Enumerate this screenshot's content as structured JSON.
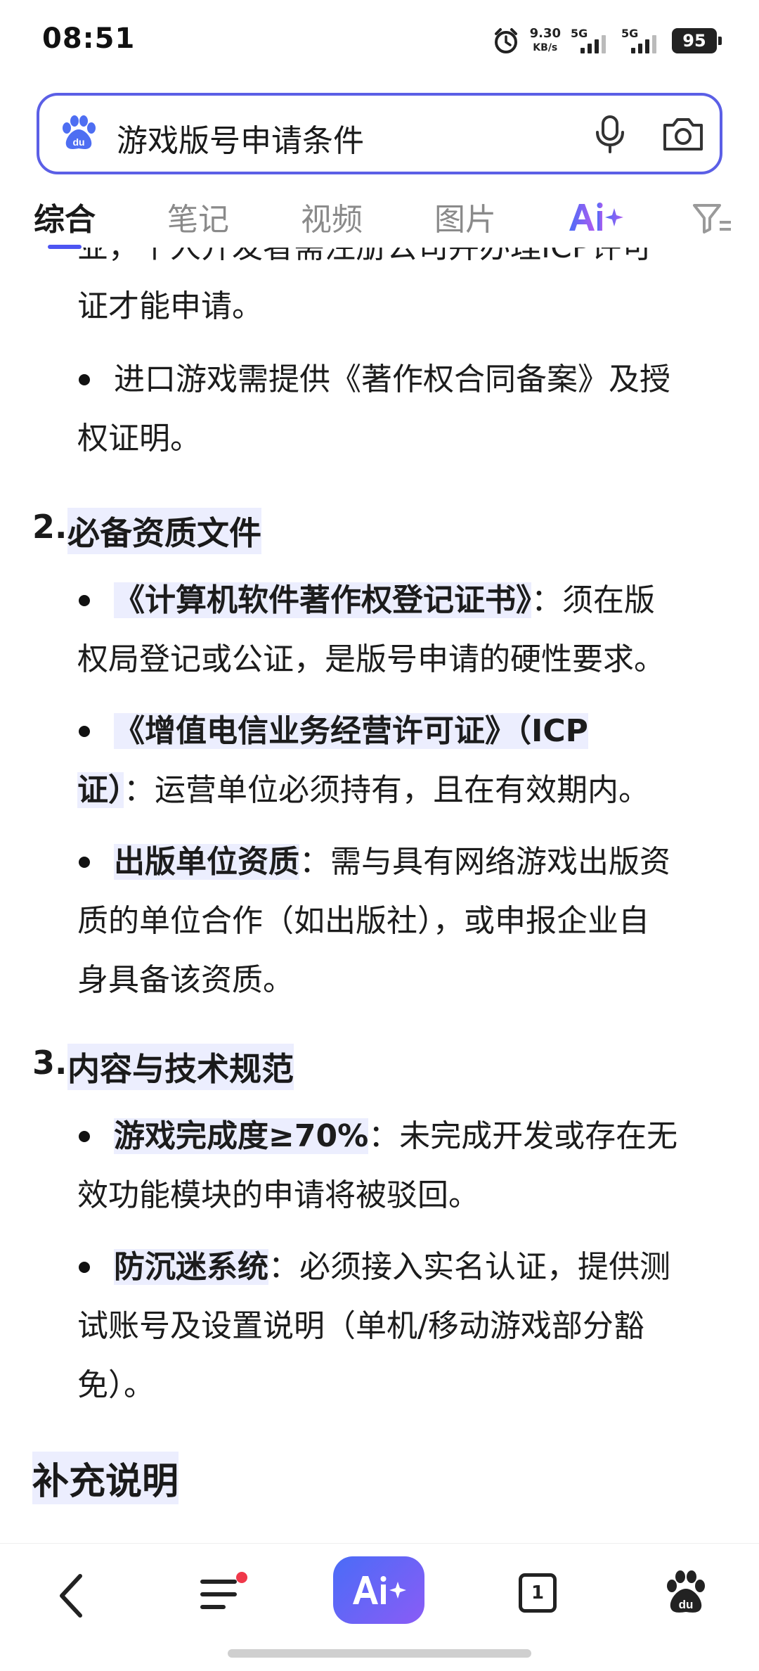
{
  "status": {
    "time": "08:51",
    "speed_value": "9.30",
    "speed_unit": "KB/s",
    "sim1": "5G",
    "sim2": "5G",
    "battery": "95"
  },
  "search": {
    "query": "游戏版号申请条件"
  },
  "tabs": [
    {
      "label": "综合",
      "active": true
    },
    {
      "label": "笔记"
    },
    {
      "label": "视频"
    },
    {
      "label": "图片"
    }
  ],
  "content": {
    "p1_line1": "业，个人开发者需注册公司并办理ICP许可",
    "p1_line2": "证才能申请。",
    "b_import_line1": "进口游戏需提供《著作权合同备案》及授",
    "b_import_line2": "权证明。",
    "s2_num": "2.",
    "s2_title": "必备资质文件",
    "b_cert_title": "《计算机软件著作权登记证书》",
    "b_cert_rest1": "：须在版",
    "b_cert_line2": "权局登记或公证，是版号申请的硬性要求。",
    "b_icp_title1": "《增值电信业务经营许可证》（ICP",
    "b_icp_title2": "证）",
    "b_icp_rest": "：运营单位必须持有，且在有效期内。",
    "b_pub_title": "出版单位资质",
    "b_pub_rest1": "：需与具有网络游戏出版资",
    "b_pub_line2": "质的单位合作（如出版社），或申报企业自",
    "b_pub_line3": "身具备该资质。",
    "s3_num": "3.",
    "s3_title": "内容与技术规范",
    "b_done_title": "游戏完成度≥70%",
    "b_done_rest1": "：未完成开发或存在无",
    "b_done_line2": "效功能模块的申请将被驳回。",
    "b_anti_title": "防沉迷系统",
    "b_anti_rest1": "：必须接入实名认证，提供测",
    "b_anti_line2": "试账号及设置说明（单机/移动游戏部分豁",
    "b_anti_line3": "免）。",
    "extra_title": "补充说明"
  },
  "bottom": {
    "tabs_count": "1",
    "accent": "#5b5fe6"
  }
}
